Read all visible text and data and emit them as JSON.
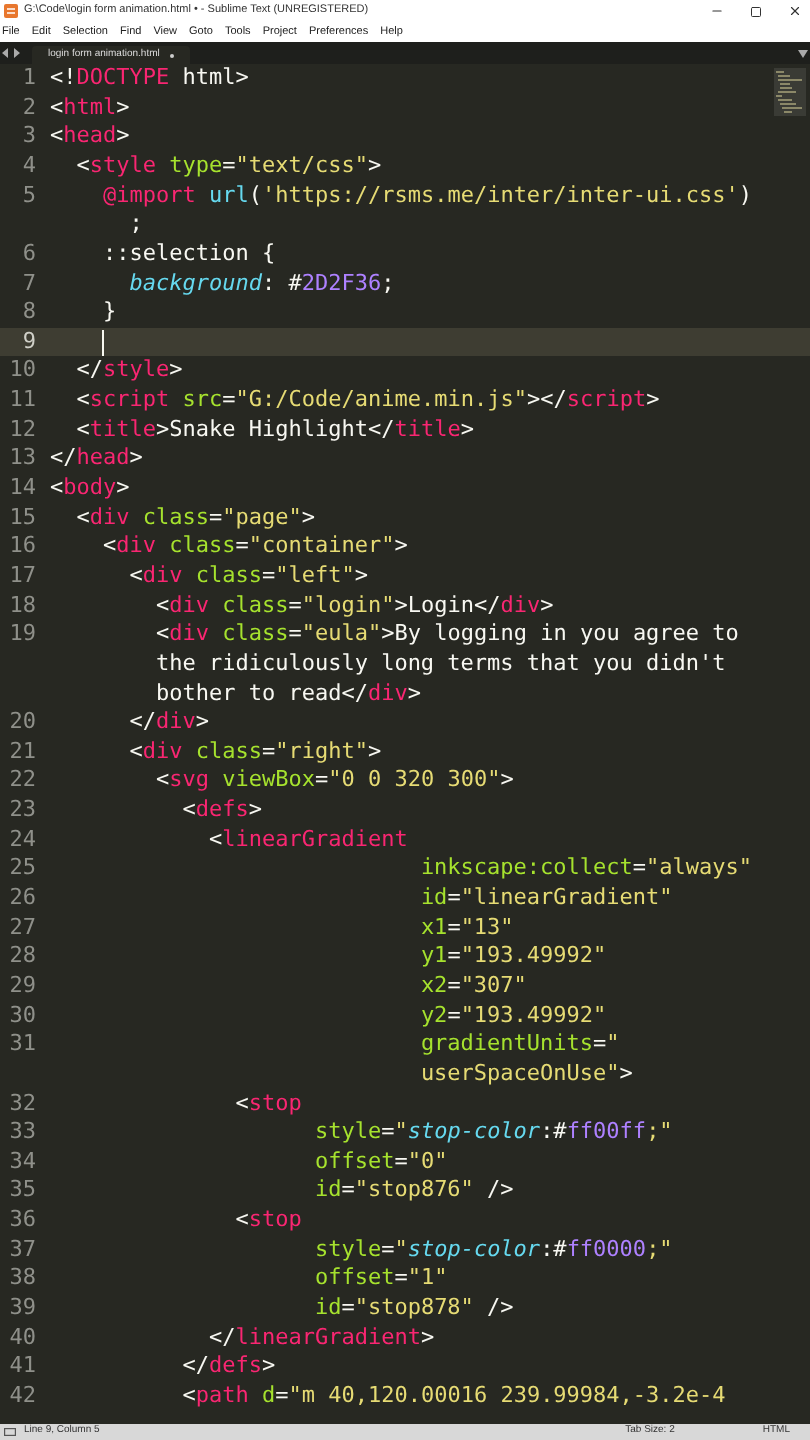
{
  "window": {
    "title": "G:\\Code\\login form animation.html • - Sublime Text (UNREGISTERED)"
  },
  "menu": [
    "File",
    "Edit",
    "Selection",
    "Find",
    "View",
    "Goto",
    "Tools",
    "Project",
    "Preferences",
    "Help"
  ],
  "tabs": [
    {
      "label": "login form animation.html",
      "selected": true
    }
  ],
  "lines": [
    {
      "number": "1",
      "current": false,
      "rows": [
        {
          "tokens": [
            {
              "kind": "plain",
              "text": "<!"
            },
            {
              "kind": "tag",
              "text": "DOCTYPE"
            },
            {
              "kind": "plain",
              "text": " html>"
            }
          ]
        }
      ]
    },
    {
      "number": "2",
      "current": false,
      "rows": [
        {
          "tokens": [
            {
              "kind": "plain",
              "text": "<"
            },
            {
              "kind": "tag",
              "text": "html"
            },
            {
              "kind": "plain",
              "text": ">"
            }
          ]
        }
      ]
    },
    {
      "number": "3",
      "current": false,
      "rows": [
        {
          "tokens": [
            {
              "kind": "plain",
              "text": "<"
            },
            {
              "kind": "tag",
              "text": "head"
            },
            {
              "kind": "plain",
              "text": ">"
            }
          ]
        }
      ]
    },
    {
      "number": "4",
      "current": false,
      "rows": [
        {
          "indent": "  ",
          "tokens": [
            {
              "kind": "plain",
              "text": "<"
            },
            {
              "kind": "tag",
              "text": "style"
            },
            {
              "kind": "attr",
              "text": " type"
            },
            {
              "kind": "plain",
              "text": "="
            },
            {
              "kind": "string",
              "text": "\"text/css\""
            },
            {
              "kind": "plain",
              "text": ">"
            }
          ]
        }
      ]
    },
    {
      "number": "5",
      "current": false,
      "rows": [
        {
          "indent": "    ",
          "tokens": [
            {
              "kind": "tag",
              "text": "@import"
            },
            {
              "kind": "support",
              "text": " url"
            },
            {
              "kind": "plain",
              "text": "("
            },
            {
              "kind": "string",
              "text": "'https://rsms.me/inter/inter-ui.css'"
            },
            {
              "kind": "plain",
              "text": ")"
            }
          ]
        },
        {
          "indent": "      ",
          "tokens": [
            {
              "kind": "plain",
              "text": ";"
            }
          ]
        }
      ]
    },
    {
      "number": "6",
      "current": false,
      "rows": [
        {
          "indent": "    ",
          "tokens": [
            {
              "kind": "plain",
              "text": "::selection {"
            }
          ]
        }
      ]
    },
    {
      "number": "7",
      "current": false,
      "rows": [
        {
          "indent": "      ",
          "tokens": [
            {
              "kind": "property",
              "text": "background"
            },
            {
              "kind": "plain",
              "text": ": #"
            },
            {
              "kind": "number",
              "text": "2D2F36"
            },
            {
              "kind": "plain",
              "text": ";"
            }
          ]
        }
      ]
    },
    {
      "number": "8",
      "current": false,
      "rows": [
        {
          "indent": "    ",
          "tokens": [
            {
              "kind": "plain",
              "text": "}"
            }
          ]
        }
      ]
    },
    {
      "number": "9",
      "current": true
    },
    {
      "number": "10",
      "current": false,
      "rows": [
        {
          "indent": "  ",
          "tokens": [
            {
              "kind": "plain",
              "text": "</"
            },
            {
              "kind": "tag",
              "text": "style"
            },
            {
              "kind": "plain",
              "text": ">"
            }
          ]
        }
      ]
    },
    {
      "number": "11",
      "current": false,
      "rows": [
        {
          "indent": "  ",
          "tokens": [
            {
              "kind": "plain",
              "text": "<"
            },
            {
              "kind": "tag",
              "text": "script"
            },
            {
              "kind": "attr",
              "text": " src"
            },
            {
              "kind": "plain",
              "text": "="
            },
            {
              "kind": "string",
              "text": "\"G:/Code/anime.min.js\""
            },
            {
              "kind": "plain",
              "text": "></"
            },
            {
              "kind": "tag",
              "text": "script"
            },
            {
              "kind": "plain",
              "text": ">"
            }
          ]
        }
      ]
    },
    {
      "number": "12",
      "current": false,
      "rows": [
        {
          "indent": "  ",
          "tokens": [
            {
              "kind": "plain",
              "text": "<"
            },
            {
              "kind": "tag",
              "text": "title"
            },
            {
              "kind": "plain",
              "text": ">Snake Highlight</"
            },
            {
              "kind": "tag",
              "text": "title"
            },
            {
              "kind": "plain",
              "text": ">"
            }
          ]
        }
      ]
    },
    {
      "number": "13",
      "current": false,
      "rows": [
        {
          "tokens": [
            {
              "kind": "plain",
              "text": "</"
            },
            {
              "kind": "tag",
              "text": "head"
            },
            {
              "kind": "plain",
              "text": ">"
            }
          ]
        }
      ]
    },
    {
      "number": "14",
      "current": false,
      "rows": [
        {
          "tokens": [
            {
              "kind": "plain",
              "text": "<"
            },
            {
              "kind": "tag",
              "text": "body"
            },
            {
              "kind": "plain",
              "text": ">"
            }
          ]
        }
      ]
    },
    {
      "number": "15",
      "current": false,
      "rows": [
        {
          "indent": "  ",
          "tokens": [
            {
              "kind": "plain",
              "text": "<"
            },
            {
              "kind": "tag",
              "text": "div"
            },
            {
              "kind": "attr",
              "text": " class"
            },
            {
              "kind": "plain",
              "text": "="
            },
            {
              "kind": "string",
              "text": "\"page\""
            },
            {
              "kind": "plain",
              "text": ">"
            }
          ]
        }
      ]
    },
    {
      "number": "16",
      "current": false,
      "rows": [
        {
          "indent": "    ",
          "tokens": [
            {
              "kind": "plain",
              "text": "<"
            },
            {
              "kind": "tag",
              "text": "div"
            },
            {
              "kind": "attr",
              "text": " class"
            },
            {
              "kind": "plain",
              "text": "="
            },
            {
              "kind": "string",
              "text": "\"container\""
            },
            {
              "kind": "plain",
              "text": ">"
            }
          ]
        }
      ]
    },
    {
      "number": "17",
      "current": false,
      "rows": [
        {
          "indent": "      ",
          "tokens": [
            {
              "kind": "plain",
              "text": "<"
            },
            {
              "kind": "tag",
              "text": "div"
            },
            {
              "kind": "attr",
              "text": " class"
            },
            {
              "kind": "plain",
              "text": "="
            },
            {
              "kind": "string",
              "text": "\"left\""
            },
            {
              "kind": "plain",
              "text": ">"
            }
          ]
        }
      ]
    },
    {
      "number": "18",
      "current": false,
      "rows": [
        {
          "indent": "        ",
          "tokens": [
            {
              "kind": "plain",
              "text": "<"
            },
            {
              "kind": "tag",
              "text": "div"
            },
            {
              "kind": "attr",
              "text": " class"
            },
            {
              "kind": "plain",
              "text": "="
            },
            {
              "kind": "string",
              "text": "\"login\""
            },
            {
              "kind": "plain",
              "text": ">Login</"
            },
            {
              "kind": "tag",
              "text": "div"
            },
            {
              "kind": "plain",
              "text": ">"
            }
          ]
        }
      ]
    },
    {
      "number": "19",
      "current": false,
      "rows": [
        {
          "indent": "        ",
          "tokens": [
            {
              "kind": "plain",
              "text": "<"
            },
            {
              "kind": "tag",
              "text": "div"
            },
            {
              "kind": "attr",
              "text": " class"
            },
            {
              "kind": "plain",
              "text": "="
            },
            {
              "kind": "string",
              "text": "\"eula\""
            },
            {
              "kind": "plain",
              "text": ">By logging in you agree to"
            }
          ]
        },
        {
          "indent": "        ",
          "tokens": [
            {
              "kind": "plain",
              "text": "the ridiculously long terms that you didn't"
            }
          ]
        },
        {
          "indent": "        ",
          "tokens": [
            {
              "kind": "plain",
              "text": "bother to read</"
            },
            {
              "kind": "tag",
              "text": "div"
            },
            {
              "kind": "plain",
              "text": ">"
            }
          ]
        }
      ]
    },
    {
      "number": "20",
      "current": false,
      "rows": [
        {
          "indent": "      ",
          "tokens": [
            {
              "kind": "plain",
              "text": "</"
            },
            {
              "kind": "tag",
              "text": "div"
            },
            {
              "kind": "plain",
              "text": ">"
            }
          ]
        }
      ]
    },
    {
      "number": "21",
      "current": false,
      "rows": [
        {
          "indent": "      ",
          "tokens": [
            {
              "kind": "plain",
              "text": "<"
            },
            {
              "kind": "tag",
              "text": "div"
            },
            {
              "kind": "attr",
              "text": " class"
            },
            {
              "kind": "plain",
              "text": "="
            },
            {
              "kind": "string",
              "text": "\"right\""
            },
            {
              "kind": "plain",
              "text": ">"
            }
          ]
        }
      ]
    },
    {
      "number": "22",
      "current": false,
      "rows": [
        {
          "indent": "        ",
          "tokens": [
            {
              "kind": "plain",
              "text": "<"
            },
            {
              "kind": "tag",
              "text": "svg"
            },
            {
              "kind": "attr",
              "text": " viewBox"
            },
            {
              "kind": "plain",
              "text": "="
            },
            {
              "kind": "string",
              "text": "\"0 0 320 300\""
            },
            {
              "kind": "plain",
              "text": ">"
            }
          ]
        }
      ]
    },
    {
      "number": "23",
      "current": false,
      "rows": [
        {
          "indent": "          ",
          "tokens": [
            {
              "kind": "plain",
              "text": "<"
            },
            {
              "kind": "tag",
              "text": "defs"
            },
            {
              "kind": "plain",
              "text": ">"
            }
          ]
        }
      ]
    },
    {
      "number": "24",
      "current": false,
      "rows": [
        {
          "indent": "            ",
          "tokens": [
            {
              "kind": "plain",
              "text": "<"
            },
            {
              "kind": "tag",
              "text": "linearGradient"
            }
          ]
        }
      ]
    },
    {
      "number": "25",
      "current": false,
      "rows": [
        {
          "indent": "                            ",
          "tokens": [
            {
              "kind": "attr",
              "text": "inkscape:collect"
            },
            {
              "kind": "plain",
              "text": "="
            },
            {
              "kind": "string",
              "text": "\"always\""
            }
          ]
        }
      ]
    },
    {
      "number": "26",
      "current": false,
      "rows": [
        {
          "indent": "                            ",
          "tokens": [
            {
              "kind": "attr",
              "text": "id"
            },
            {
              "kind": "plain",
              "text": "="
            },
            {
              "kind": "string",
              "text": "\"linearGradient\""
            }
          ]
        }
      ]
    },
    {
      "number": "27",
      "current": false,
      "rows": [
        {
          "indent": "                            ",
          "tokens": [
            {
              "kind": "attr",
              "text": "x1"
            },
            {
              "kind": "plain",
              "text": "="
            },
            {
              "kind": "string",
              "text": "\"13\""
            }
          ]
        }
      ]
    },
    {
      "number": "28",
      "current": false,
      "rows": [
        {
          "indent": "                            ",
          "tokens": [
            {
              "kind": "attr",
              "text": "y1"
            },
            {
              "kind": "plain",
              "text": "="
            },
            {
              "kind": "string",
              "text": "\"193.49992\""
            }
          ]
        }
      ]
    },
    {
      "number": "29",
      "current": false,
      "rows": [
        {
          "indent": "                            ",
          "tokens": [
            {
              "kind": "attr",
              "text": "x2"
            },
            {
              "kind": "plain",
              "text": "="
            },
            {
              "kind": "string",
              "text": "\"307\""
            }
          ]
        }
      ]
    },
    {
      "number": "30",
      "current": false,
      "rows": [
        {
          "indent": "                            ",
          "tokens": [
            {
              "kind": "attr",
              "text": "y2"
            },
            {
              "kind": "plain",
              "text": "="
            },
            {
              "kind": "string",
              "text": "\"193.49992\""
            }
          ]
        }
      ]
    },
    {
      "number": "31",
      "current": false,
      "rows": [
        {
          "indent": "                            ",
          "tokens": [
            {
              "kind": "attr",
              "text": "gradientUnits"
            },
            {
              "kind": "plain",
              "text": "="
            },
            {
              "kind": "string",
              "text": "\""
            }
          ]
        },
        {
          "indent": "                            ",
          "tokens": [
            {
              "kind": "string",
              "text": "userSpaceOnUse\""
            },
            {
              "kind": "plain",
              "text": ">"
            }
          ]
        }
      ]
    },
    {
      "number": "32",
      "current": false,
      "rows": [
        {
          "indent": "              ",
          "tokens": [
            {
              "kind": "plain",
              "text": "<"
            },
            {
              "kind": "tag",
              "text": "stop"
            }
          ]
        }
      ]
    },
    {
      "number": "33",
      "current": false,
      "rows": [
        {
          "indent": "                    ",
          "tokens": [
            {
              "kind": "attr",
              "text": "style"
            },
            {
              "kind": "plain",
              "text": "="
            },
            {
              "kind": "string",
              "text": "\""
            },
            {
              "kind": "property",
              "text": "stop-color"
            },
            {
              "kind": "plain",
              "text": ":#"
            },
            {
              "kind": "number",
              "text": "ff00ff"
            },
            {
              "kind": "string",
              "text": ";\""
            }
          ]
        }
      ]
    },
    {
      "number": "34",
      "current": false,
      "rows": [
        {
          "indent": "                    ",
          "tokens": [
            {
              "kind": "attr",
              "text": "offset"
            },
            {
              "kind": "plain",
              "text": "="
            },
            {
              "kind": "string",
              "text": "\"0\""
            }
          ]
        }
      ]
    },
    {
      "number": "35",
      "current": false,
      "rows": [
        {
          "indent": "                    ",
          "tokens": [
            {
              "kind": "attr",
              "text": "id"
            },
            {
              "kind": "plain",
              "text": "="
            },
            {
              "kind": "string",
              "text": "\"stop876\""
            },
            {
              "kind": "plain",
              "text": " />"
            }
          ]
        }
      ]
    },
    {
      "number": "36",
      "current": false,
      "rows": [
        {
          "indent": "              ",
          "tokens": [
            {
              "kind": "plain",
              "text": "<"
            },
            {
              "kind": "tag",
              "text": "stop"
            }
          ]
        }
      ]
    },
    {
      "number": "37",
      "current": false,
      "rows": [
        {
          "indent": "                    ",
          "tokens": [
            {
              "kind": "attr",
              "text": "style"
            },
            {
              "kind": "plain",
              "text": "="
            },
            {
              "kind": "string",
              "text": "\""
            },
            {
              "kind": "property",
              "text": "stop-color"
            },
            {
              "kind": "plain",
              "text": ":#"
            },
            {
              "kind": "number",
              "text": "ff0000"
            },
            {
              "kind": "string",
              "text": ";\""
            }
          ]
        }
      ]
    },
    {
      "number": "38",
      "current": false,
      "rows": [
        {
          "indent": "                    ",
          "tokens": [
            {
              "kind": "attr",
              "text": "offset"
            },
            {
              "kind": "plain",
              "text": "="
            },
            {
              "kind": "string",
              "text": "\"1\""
            }
          ]
        }
      ]
    },
    {
      "number": "39",
      "current": false,
      "rows": [
        {
          "indent": "                    ",
          "tokens": [
            {
              "kind": "attr",
              "text": "id"
            },
            {
              "kind": "plain",
              "text": "="
            },
            {
              "kind": "string",
              "text": "\"stop878\""
            },
            {
              "kind": "plain",
              "text": " />"
            }
          ]
        }
      ]
    },
    {
      "number": "40",
      "current": false,
      "rows": [
        {
          "indent": "            ",
          "tokens": [
            {
              "kind": "plain",
              "text": "</"
            },
            {
              "kind": "tag",
              "text": "linearGradient"
            },
            {
              "kind": "plain",
              "text": ">"
            }
          ]
        }
      ]
    },
    {
      "number": "41",
      "current": false,
      "rows": [
        {
          "indent": "          ",
          "tokens": [
            {
              "kind": "plain",
              "text": "</"
            },
            {
              "kind": "tag",
              "text": "defs"
            },
            {
              "kind": "plain",
              "text": ">"
            }
          ]
        }
      ]
    },
    {
      "number": "42",
      "current": false,
      "rows": [
        {
          "indent": "          ",
          "tokens": [
            {
              "kind": "plain",
              "text": "<"
            },
            {
              "kind": "tag",
              "text": "path"
            },
            {
              "kind": "attr",
              "text": " d"
            },
            {
              "kind": "plain",
              "text": "="
            },
            {
              "kind": "string",
              "text": "\"m 40,120.00016 239.99984,-3.2e-4"
            }
          ]
        }
      ]
    }
  ],
  "status_bar": {
    "position": "Line 9, Column 5",
    "tab_size": "Tab Size: 2",
    "syntax": "HTML"
  }
}
